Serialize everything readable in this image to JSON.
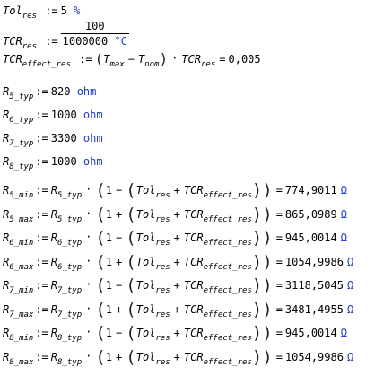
{
  "tol": {
    "name": "Tol",
    "sub": "res",
    "value": "5",
    "unit": "%"
  },
  "tcr": {
    "name": "TCR",
    "sub": "res",
    "numerator": "100",
    "denominator": "1000000",
    "unit": "°C"
  },
  "tcr_eff": {
    "name": "TCR",
    "sub": "effect_res",
    "tmax": "T",
    "tmax_sub": "max",
    "tnom": "T",
    "tnom_sub": "nom",
    "tcr": "TCR",
    "tcr_sub": "res",
    "result": "0,005"
  },
  "resistors": [
    {
      "name": "R",
      "sub": "5_typ",
      "value": "820",
      "unit": "ohm"
    },
    {
      "name": "R",
      "sub": "6_typ",
      "value": "1000",
      "unit": "ohm"
    },
    {
      "name": "R",
      "sub": "7_typ",
      "value": "3300",
      "unit": "ohm"
    },
    {
      "name": "R",
      "sub": "8_typ",
      "value": "1000",
      "unit": "ohm"
    }
  ],
  "limits": [
    {
      "name": "R",
      "sub": "5_min",
      "ref": "R",
      "ref_sub": "5_typ",
      "one": "1",
      "op": "−",
      "tol": "Tol",
      "tol_sub": "res",
      "tcr": "TCR",
      "tcr_sub": "effect_res",
      "result": "774,9011",
      "unit": "Ω"
    },
    {
      "name": "R",
      "sub": "5_max",
      "ref": "R",
      "ref_sub": "5_typ",
      "one": "1",
      "op": "+",
      "tol": "Tol",
      "tol_sub": "res",
      "tcr": "TCR",
      "tcr_sub": "effect_res",
      "result": "865,0989",
      "unit": "Ω"
    },
    {
      "name": "R",
      "sub": "6_min",
      "ref": "R",
      "ref_sub": "6_typ",
      "one": "1",
      "op": "−",
      "tol": "Tol",
      "tol_sub": "res",
      "tcr": "TCR",
      "tcr_sub": "effect_res",
      "result": "945,0014",
      "unit": "Ω"
    },
    {
      "name": "R",
      "sub": "6_max",
      "ref": "R",
      "ref_sub": "6_typ",
      "one": "1",
      "op": "+",
      "tol": "Tol",
      "tol_sub": "res",
      "tcr": "TCR",
      "tcr_sub": "effect_res",
      "result": "1054,9986",
      "unit": "Ω"
    },
    {
      "name": "R",
      "sub": "7_min",
      "ref": "R",
      "ref_sub": "7_typ",
      "one": "1",
      "op": "−",
      "tol": "Tol",
      "tol_sub": "res",
      "tcr": "TCR",
      "tcr_sub": "effect_res",
      "result": "3118,5045",
      "unit": "Ω"
    },
    {
      "name": "R",
      "sub": "7_max",
      "ref": "R",
      "ref_sub": "7_typ",
      "one": "1",
      "op": "+",
      "tol": "Tol",
      "tol_sub": "res",
      "tcr": "TCR",
      "tcr_sub": "effect_res",
      "result": "3481,4955",
      "unit": "Ω"
    },
    {
      "name": "R",
      "sub": "8_min",
      "ref": "R",
      "ref_sub": "8_typ",
      "one": "1",
      "op": "−",
      "tol": "Tol",
      "tol_sub": "res",
      "tcr": "TCR",
      "tcr_sub": "effect_res",
      "result": "945,0014",
      "unit": "Ω"
    },
    {
      "name": "R",
      "sub": "8_max",
      "ref": "R",
      "ref_sub": "8_typ",
      "one": "1",
      "op": "+",
      "tol": "Tol",
      "tol_sub": "res",
      "tcr": "TCR",
      "tcr_sub": "effect_res",
      "result": "1054,9986",
      "unit": "Ω"
    }
  ],
  "symbols": {
    "assign": ":=",
    "equals": "=",
    "dot": "·",
    "minus": "−",
    "plus": "+",
    "open": "(",
    "close": ")"
  }
}
